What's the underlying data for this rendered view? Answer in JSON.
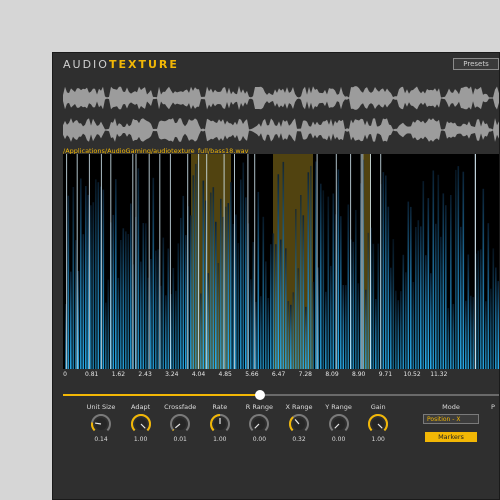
{
  "header": {
    "title_part1": "AUDIO",
    "title_part2": "TEXTURE",
    "presets_label": "Presets"
  },
  "file_path": "/Applications/AudioGaming/audiotexture_full/bass18.wav",
  "timeline": {
    "ticks": [
      "0",
      "0.81",
      "1.62",
      "2.43",
      "3.24",
      "4.04",
      "4.85",
      "5.66",
      "6.47",
      "7.28",
      "8.09",
      "8.90",
      "9.71",
      "10.52",
      "11.32"
    ]
  },
  "position_slider": {
    "value": 0.45
  },
  "knobs": [
    {
      "label": "Unit Size",
      "value": "0.14",
      "level": 0.2
    },
    {
      "label": "Adapt",
      "value": "1.00",
      "level": 1.0
    },
    {
      "label": "Crossfade",
      "value": "0.01",
      "level": 0.02
    },
    {
      "label": "Rate",
      "value": "1.00",
      "level": 0.5
    },
    {
      "label": "R Range",
      "value": "0.00",
      "level": 0.0
    },
    {
      "label": "X Range",
      "value": "0.32",
      "level": 0.35
    },
    {
      "label": "Y Range",
      "value": "0.00",
      "level": 0.0
    },
    {
      "label": "Gain",
      "value": "1.00",
      "level": 1.0
    }
  ],
  "mode": {
    "label": "Mode",
    "selected": "Position - X",
    "markers_label": "Markers"
  },
  "extra_label": "P",
  "colors": {
    "accent": "#f2b705",
    "background": "#2f2f2f",
    "spectrogram_low": "#2ab0f0"
  }
}
